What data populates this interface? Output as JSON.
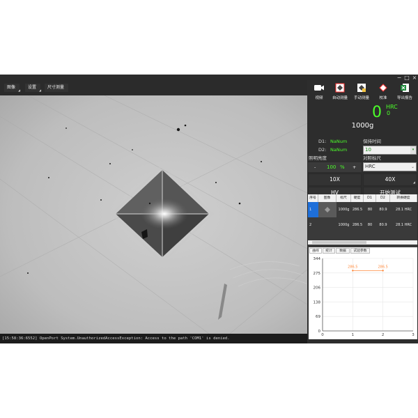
{
  "window": {
    "minimize": "−",
    "maximize": "□",
    "close": "×"
  },
  "menubar": {
    "items": [
      {
        "label": "图像"
      },
      {
        "label": "设置"
      },
      {
        "label": "尺寸测量"
      }
    ]
  },
  "status": {
    "message": "[15:58:36:6552] OpenPort System.UnauthorizedAccessException: Access to the path 'COM1' is denied."
  },
  "toolbar": {
    "items": [
      {
        "label": "视频",
        "icon": "video-camera-icon"
      },
      {
        "label": "自动测量",
        "icon": "auto-measure-icon"
      },
      {
        "label": "手动测量",
        "icon": "manual-measure-icon"
      },
      {
        "label": "校准",
        "icon": "calibrate-icon"
      },
      {
        "label": "导出报告",
        "icon": "excel-export-icon"
      }
    ]
  },
  "reading": {
    "value": "0",
    "unit": "HRC",
    "unit_value": "0",
    "load": "1000g"
  },
  "params": {
    "d1_label": "D1:",
    "d1_value": "NaNum",
    "d2_label": "D2:",
    "d2_value": "NaNum",
    "hold_time_label": "保持时间",
    "hold_time_value": "10",
    "brightness_label": "照明亮度",
    "brightness_minus": "-",
    "brightness_value": "100",
    "brightness_unit": "%",
    "brightness_plus": "+",
    "convert_label": "对照标尺",
    "convert_value": "HRC"
  },
  "buttons": {
    "obj10": "10X",
    "obj40": "40X",
    "hv": "HV",
    "start": "开始测试"
  },
  "table": {
    "headers": [
      "序号",
      "图像",
      "标尺",
      "硬度",
      "D1",
      "D2",
      "转换硬度"
    ],
    "rows": [
      {
        "index": "1",
        "load": "1000g",
        "hardness": "286.5",
        "d1": "80",
        "d2": "80.9",
        "converted": "28.1 HRC"
      },
      {
        "index": "2",
        "load": "1000g",
        "hardness": "286.5",
        "d1": "80",
        "d2": "80.9",
        "converted": "28.1 HRC"
      }
    ]
  },
  "chart_tabs": [
    "曲线",
    "统计",
    "数据",
    "试验参数"
  ],
  "colors": {
    "accent_green": "#4cff2a",
    "selected_blue": "#1e6fd9",
    "curve_orange": "#ff8a3d"
  },
  "chart_data": {
    "type": "line",
    "x": [
      1,
      2
    ],
    "series": [
      {
        "values": [
          286.5,
          286.5
        ]
      }
    ],
    "data_labels": [
      "286.5",
      "286.5"
    ],
    "xlim": [
      0,
      3
    ],
    "ylim": [
      0,
      344
    ],
    "y_ticks": [
      0,
      69,
      138,
      206,
      275,
      344
    ],
    "x_ticks": [
      0,
      1,
      2,
      3
    ],
    "grid": true
  }
}
